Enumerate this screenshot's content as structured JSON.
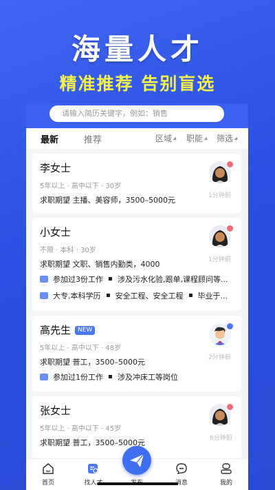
{
  "promo": {
    "title": "海量人才",
    "subtitle": "精准推荐 告别盲选"
  },
  "search": {
    "placeholder": "请输入简历关键字，例如：销售"
  },
  "tabs": [
    {
      "label": "最新",
      "active": true
    },
    {
      "label": "推荐",
      "active": false
    }
  ],
  "filters": [
    {
      "label": "区域"
    },
    {
      "label": "职能"
    },
    {
      "label": "筛选"
    }
  ],
  "candidates": [
    {
      "name": "李女士",
      "badge": "",
      "meta": "5年以上 · 高中以下 · 30岁",
      "expect": "求职期望 主播、美容师，3500–5000元",
      "time": "1分钟前",
      "avatar": "female-avatar-icon",
      "status_color": "#f06b7a",
      "lines": []
    },
    {
      "name": "小女士",
      "badge": "",
      "meta": "不限 · 本科 · 30岁",
      "expect": "求职期望 文职、销售内勤类，4000",
      "time": "1分钟前",
      "avatar": "female-avatar-icon",
      "status_color": "#f06b7a",
      "lines": [
        {
          "icon": "briefcase-icon",
          "first": "参加过3份工作",
          "second": "涉及污水化验,跟单,课程顾问等..."
        },
        {
          "icon": "graduation-icon",
          "first": "大专,本科学历",
          "second": "安全工程、安全工程",
          "third": "毕业于..."
        }
      ]
    },
    {
      "name": "高先生",
      "badge": "NEW",
      "meta": "5年以上 · 高中以下 · 48岁",
      "expect": "求职期望 普工，3500–5000元",
      "time": "2分钟前",
      "avatar": "male-avatar-icon",
      "status_color": "#4a78f4",
      "lines": [
        {
          "icon": "briefcase-icon",
          "first": "参加过1份工作",
          "second": "涉及冲床工等岗位"
        }
      ]
    },
    {
      "name": "张女士",
      "badge": "",
      "meta": "5年以上 · 高中以下 · 45岁",
      "expect": "求职期望 普工，3500–5000元",
      "time": "6分钟前",
      "avatar": "female-avatar-icon",
      "status_color": "#f06b7a",
      "lines": []
    }
  ],
  "nav": [
    {
      "label": "首页",
      "icon": "home-icon",
      "active": false
    },
    {
      "label": "找人才",
      "icon": "find-talent-icon",
      "active": true
    },
    {
      "label": "发布",
      "icon": "send-icon",
      "active": false
    },
    {
      "label": "消息",
      "icon": "message-icon",
      "active": false
    },
    {
      "label": "我的",
      "icon": "profile-icon",
      "active": false
    }
  ],
  "colors": {
    "brand": "#3a61ee",
    "accent_yellow": "#f3f04a",
    "badge_blue": "#4a78f4"
  }
}
